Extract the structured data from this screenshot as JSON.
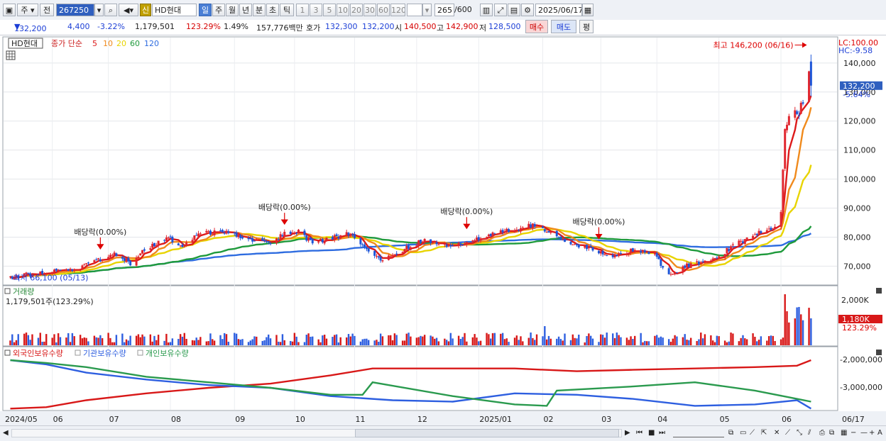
{
  "toolbar": {
    "market": "주",
    "prev": "전",
    "code": "267250",
    "sin": "신",
    "name": "HD현대",
    "periods": [
      "일",
      "주",
      "월",
      "년",
      "분",
      "초",
      "틱"
    ],
    "active_period": "일",
    "intervals": [
      "1",
      "3",
      "5",
      "10",
      "20",
      "30",
      "60",
      "120"
    ],
    "count": "265",
    "count_total": "/600",
    "date": "2025/06/17"
  },
  "quote": {
    "price": "132,200",
    "change": "4,400",
    "change_pct": "-3.22%",
    "volume": "1,179,501",
    "vol_ratio": "123.29%",
    "turnover_pct": "1.49%",
    "amount": "157,776백만",
    "hoga_label": "호가",
    "ask": "132,300",
    "bid": "132,200",
    "open_label": "시",
    "open": "140,500",
    "high_label": "고",
    "high": "142,900",
    "low_label": "저",
    "low": "128,500",
    "buy": "매수",
    "sell": "매도",
    "avg": "평"
  },
  "price_panel": {
    "name_tag": "HD현대",
    "legend_prefix": "종가 단순",
    "ma": [
      {
        "period": "5",
        "color": "#dd1a1a"
      },
      {
        "period": "10",
        "color": "#f08a1c"
      },
      {
        "period": "20",
        "color": "#e8d400"
      },
      {
        "period": "60",
        "color": "#1f9a3c"
      },
      {
        "period": "120",
        "color": "#2e6ce0"
      }
    ],
    "lc": "LC:100.00",
    "hc": "HC:-9.58",
    "max_label": "최고 146,200 (06/16)",
    "min_label": "최저 66,100 (05/13)",
    "last_price": "132,200",
    "last_pct": "-5.64%",
    "dividends": [
      "배당락(0.00%)",
      "배당락(0.00%)",
      "배당락(0.00%)",
      "배당락(0.00%)"
    ]
  },
  "volume_panel": {
    "title": "거래량",
    "value": "1,179,501주(123.29%)",
    "last": "1,180K",
    "last_pct": "123.29%",
    "tick": "2,000K"
  },
  "holdings_panel": {
    "legend": [
      {
        "label": "외국인보유수량",
        "color": "#d81818"
      },
      {
        "label": "기관보유수량",
        "color": "#2e5fe0"
      },
      {
        "label": "개인보유수량",
        "color": "#2a9a4e"
      }
    ],
    "ticks": [
      "-2,000,000",
      "-3,000,000"
    ]
  },
  "x_labels": [
    "2024/05",
    "06",
    "07",
    "08",
    "09",
    "10",
    "11",
    "12",
    "2025/01",
    "02",
    "03",
    "04",
    "05",
    "06",
    "06/17"
  ],
  "chart_data": {
    "type": "candlestick",
    "title": "HD현대",
    "y_ticks": [
      70000,
      80000,
      90000,
      100000,
      110000,
      120000,
      130000,
      140000
    ],
    "ylim": [
      63500,
      149000
    ],
    "close_path": [
      [
        "2024/05/13",
        66100
      ],
      [
        "2024/05/20",
        67000
      ],
      [
        "2024/05/31",
        67800
      ],
      [
        "2024/06/14",
        69000
      ],
      [
        "2024/06/28",
        72500
      ],
      [
        "2024/07/05",
        74200
      ],
      [
        "2024/07/12",
        71000
      ],
      [
        "2024/07/19",
        76000
      ],
      [
        "2024/07/31",
        80000
      ],
      [
        "2024/08/06",
        76500
      ],
      [
        "2024/08/16",
        81200
      ],
      [
        "2024/08/30",
        82000
      ],
      [
        "2024/09/06",
        79500
      ],
      [
        "2024/09/20",
        77500
      ],
      [
        "2024/09/27",
        81500
      ],
      [
        "2024/10/04",
        82000
      ],
      [
        "2024/10/11",
        77800
      ],
      [
        "2024/10/25",
        80500
      ],
      [
        "2024/10/31",
        81200
      ],
      [
        "2024/11/08",
        75000
      ],
      [
        "2024/11/15",
        72000
      ],
      [
        "2024/11/29",
        77000
      ],
      [
        "2024/12/06",
        79000
      ],
      [
        "2024/12/20",
        76500
      ],
      [
        "2024/12/31",
        79500
      ],
      [
        "2025/01/10",
        81000
      ],
      [
        "2025/01/24",
        83500
      ],
      [
        "2025/01/31",
        84500
      ],
      [
        "2025/02/06",
        82000
      ],
      [
        "2025/02/14",
        78000
      ],
      [
        "2025/02/28",
        76000
      ],
      [
        "2025/03/10",
        73500
      ],
      [
        "2025/03/21",
        76000
      ],
      [
        "2025/03/31",
        74000
      ],
      [
        "2025/04/07",
        66500
      ],
      [
        "2025/04/15",
        70000
      ],
      [
        "2025/04/30",
        72500
      ],
      [
        "2025/05/09",
        77000
      ],
      [
        "2025/05/20",
        81000
      ],
      [
        "2025/05/30",
        83500
      ],
      [
        "2025/06/02",
        89000
      ],
      [
        "2025/06/04",
        116000
      ],
      [
        "2025/06/05",
        120000
      ],
      [
        "2025/06/09",
        124500
      ],
      [
        "2025/06/11",
        123000
      ],
      [
        "2025/06/13",
        127000
      ],
      [
        "2025/06/16",
        136600
      ],
      [
        "2025/06/17",
        132200
      ]
    ],
    "last": {
      "date": "2025/06/17",
      "open": 140500,
      "high": 142900,
      "low": 128500,
      "close": 132200,
      "volume": 1179501
    },
    "max": {
      "date": "2025/06/16",
      "value": 146200
    },
    "min": {
      "date": "2024/05/13",
      "value": 66100
    },
    "moving_averages": [
      "5",
      "10",
      "20",
      "60",
      "120"
    ]
  }
}
